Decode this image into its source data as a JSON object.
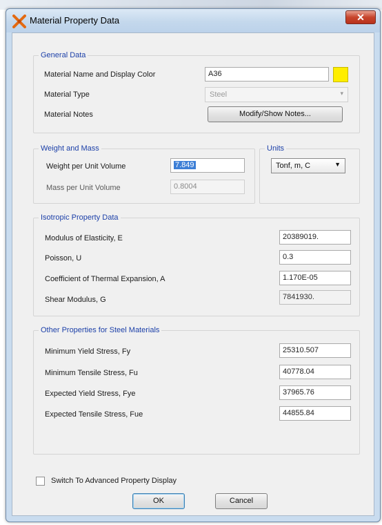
{
  "window": {
    "title": "Material Property Data",
    "close_glyph": "✕"
  },
  "general": {
    "title": "General Data",
    "name_label": "Material Name and Display Color",
    "name_value": "A36",
    "display_color": "#ffee00",
    "type_label": "Material Type",
    "type_value": "Steel",
    "notes_label": "Material Notes",
    "notes_button": "Modify/Show Notes..."
  },
  "weight_mass": {
    "title": "Weight and Mass",
    "weight_label": "Weight per Unit Volume",
    "weight_value": "7.849",
    "mass_label": "Mass per Unit Volume",
    "mass_value": "0.8004"
  },
  "units": {
    "title": "Units",
    "value": "Tonf, m, C"
  },
  "isotropic": {
    "title": "Isotropic Property Data",
    "rows": [
      {
        "label": "Modulus of Elasticity,  E",
        "value": "20389019."
      },
      {
        "label": "Poisson,  U",
        "value": "0.3"
      },
      {
        "label": "Coefficient of Thermal Expansion,  A",
        "value": "1.170E-05"
      },
      {
        "label": "Shear Modulus,  G",
        "value": "7841930."
      }
    ]
  },
  "steel": {
    "title": "Other Properties for Steel Materials",
    "rows": [
      {
        "label": "Minimum Yield Stress, Fy",
        "value": "25310.507"
      },
      {
        "label": "Minimum Tensile Stress, Fu",
        "value": "40778.04"
      },
      {
        "label": "Expected Yield Stress, Fye",
        "value": "37965.76"
      },
      {
        "label": "Expected Tensile Stress, Fue",
        "value": "44855.84"
      }
    ]
  },
  "footer": {
    "advanced_label": "Switch To Advanced Property Display",
    "ok_label": "OK",
    "cancel_label": "Cancel"
  }
}
